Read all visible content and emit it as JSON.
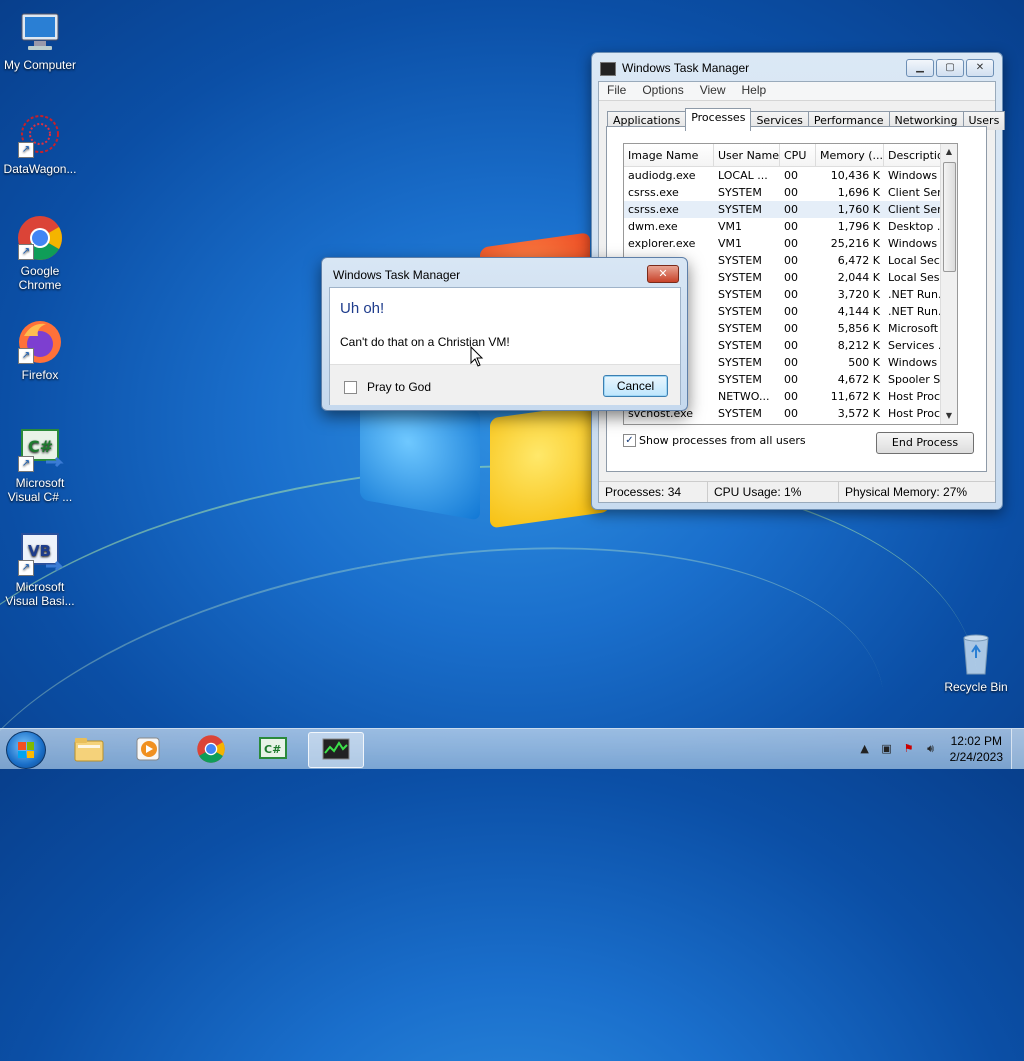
{
  "desktop": {
    "icons": [
      {
        "label": "My Computer"
      },
      {
        "label": "DataWagon..."
      },
      {
        "label": "Google Chrome"
      },
      {
        "label": "Firefox"
      },
      {
        "label": "Microsoft Visual C# ..."
      },
      {
        "label": "Microsoft Visual Basi..."
      },
      {
        "label": "Recycle Bin"
      }
    ]
  },
  "task_manager": {
    "title": "Windows Task Manager",
    "menu": [
      "File",
      "Options",
      "View",
      "Help"
    ],
    "tabs": [
      "Applications",
      "Processes",
      "Services",
      "Performance",
      "Networking",
      "Users"
    ],
    "active_tab": "Processes",
    "columns": [
      "Image Name",
      "User Name",
      "CPU",
      "Memory (...",
      "Description"
    ],
    "rows": [
      [
        "audiodg.exe",
        "LOCAL ...",
        "00",
        "10,436 K",
        "Windows ..."
      ],
      [
        "csrss.exe",
        "SYSTEM",
        "00",
        "1,696 K",
        "Client Ser..."
      ],
      [
        "csrss.exe",
        "SYSTEM",
        "00",
        "1,760 K",
        "Client Ser..."
      ],
      [
        "dwm.exe",
        "VM1",
        "00",
        "1,796 K",
        "Desktop ..."
      ],
      [
        "explorer.exe",
        "VM1",
        "00",
        "25,216 K",
        "Windows ..."
      ],
      [
        "",
        "SYSTEM",
        "00",
        "6,472 K",
        "Local Sec..."
      ],
      [
        "",
        "SYSTEM",
        "00",
        "2,044 K",
        "Local Ses..."
      ],
      [
        "exe",
        "SYSTEM",
        "00",
        "3,720 K",
        ".NET Run..."
      ],
      [
        "x...",
        "SYSTEM",
        "00",
        "4,144 K",
        ".NET Run..."
      ],
      [
        "x...",
        "SYSTEM",
        "00",
        "5,856 K",
        "Microsoft ..."
      ],
      [
        "e",
        "SYSTEM",
        "00",
        "8,212 K",
        "Services ..."
      ],
      [
        "",
        "SYSTEM",
        "00",
        "500 K",
        "Windows ..."
      ],
      [
        "",
        "SYSTEM",
        "00",
        "4,672 K",
        "Spooler S..."
      ],
      [
        "",
        "NETWO...",
        "00",
        "11,672 K",
        "Host Proc..."
      ],
      [
        "svchost.exe",
        "SYSTEM",
        "00",
        "3,572 K",
        "Host Proc..."
      ]
    ],
    "show_all_label": "Show processes from all users",
    "show_all_checked": true,
    "end_process_label": "End Process",
    "status": {
      "processes": "Processes: 34",
      "cpu": "CPU Usage: 1%",
      "memory": "Physical Memory: 27%"
    }
  },
  "dialog": {
    "title": "Windows Task Manager",
    "heading": "Uh oh!",
    "message": "Can't do that on a Christian VM!",
    "checkbox_label": "Pray to God",
    "cancel_label": "Cancel"
  },
  "taskbar": {
    "time": "12:02 PM",
    "date": "2/24/2023"
  },
  "colors": {
    "dialog_heading": "#1e3c8c",
    "desktop_bg": "#1a6fcc"
  }
}
